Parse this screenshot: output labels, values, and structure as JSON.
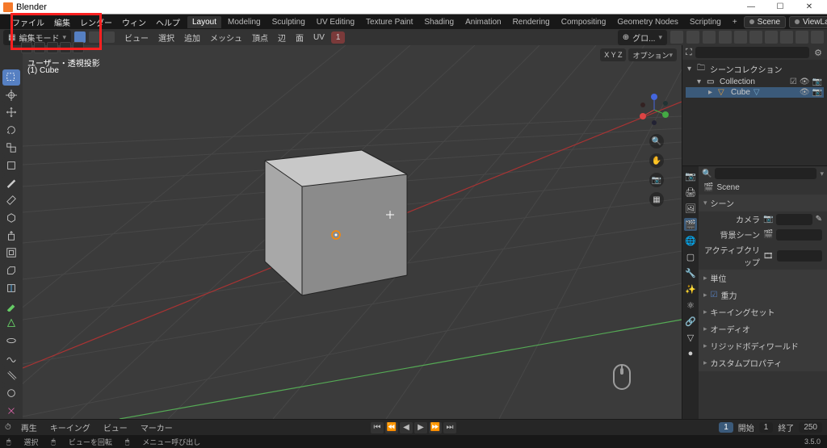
{
  "titlebar": {
    "title": "Blender"
  },
  "menus": {
    "file": "ファイル",
    "edit": "編集",
    "render": "レンダー",
    "window": "ウィン",
    "help": "ヘルプ"
  },
  "workspaces": [
    "Layout",
    "Modeling",
    "Sculpting",
    "UV Editing",
    "Texture Paint",
    "Shading",
    "Animation",
    "Rendering",
    "Compositing",
    "Geometry Nodes",
    "Scripting",
    "+"
  ],
  "scene": {
    "label": "Scene",
    "viewlayer": "ViewLayer"
  },
  "header2": {
    "mode": "編集モード",
    "menus": [
      "ビュー",
      "選択",
      "追加",
      "メッシュ",
      "頂点",
      "辺",
      "面",
      "UV"
    ],
    "global": "グロ...",
    "overlay_xyz": "X Y Z",
    "options": "オプション"
  },
  "viewport": {
    "line1": "ユーザー・透視投影",
    "line2": "(1) Cube"
  },
  "outliner": {
    "root": "シーンコレクション",
    "coll": "Collection",
    "cube": "Cube"
  },
  "properties": {
    "breadcrumb": "Scene",
    "panel_scene": "シーン",
    "camera": "カメラ",
    "bgscene": "背景シーン",
    "activeclip": "アクティブクリップ",
    "panels": [
      "単位",
      "重力",
      "キーイングセット",
      "オーディオ",
      "リジッドボディワールド",
      "カスタムプロパティ"
    ]
  },
  "timeline": {
    "menus": [
      "再生",
      "キーイング",
      "ビュー",
      "マーカー"
    ],
    "frame_label_a": "1",
    "start_label": "開始",
    "start": "1",
    "end_label": "終了",
    "end": "250"
  },
  "statusbar": {
    "select": "選択",
    "rotate": "ビューを回転",
    "context": "メニュー呼び出し",
    "version": "3.5.0"
  }
}
